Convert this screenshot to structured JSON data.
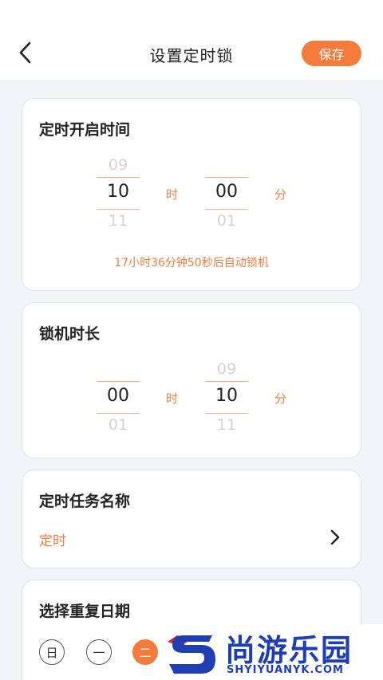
{
  "header": {
    "title": "设置定时锁",
    "save_label": "保存"
  },
  "start_time": {
    "title": "定时开启时间",
    "hour": {
      "prev": "09",
      "selected": "10",
      "next": "11",
      "unit": "时"
    },
    "minute": {
      "prev": "",
      "selected": "00",
      "next": "01",
      "unit": "分"
    },
    "countdown_text": "17小时36分钟50秒后自动锁机"
  },
  "lock_duration": {
    "title": "锁机时长",
    "hour": {
      "prev": "",
      "selected": "00",
      "next": "01",
      "unit": "时"
    },
    "minute": {
      "prev": "09",
      "selected": "10",
      "next": "11",
      "unit": "分"
    }
  },
  "task_name": {
    "title": "定时任务名称",
    "value": "定时"
  },
  "repeat": {
    "title": "选择重复日期",
    "days": [
      {
        "label": "日",
        "selected": false
      },
      {
        "label": "一",
        "selected": false
      },
      {
        "label": "二",
        "selected": true
      }
    ]
  },
  "watermark": {
    "text": "尚游乐园",
    "url_text": "SHYIYUANYK.COM"
  },
  "colors": {
    "accent": "#f57b3a",
    "watermark_blue": "#1d3fb3",
    "background": "#f3f4f8"
  }
}
